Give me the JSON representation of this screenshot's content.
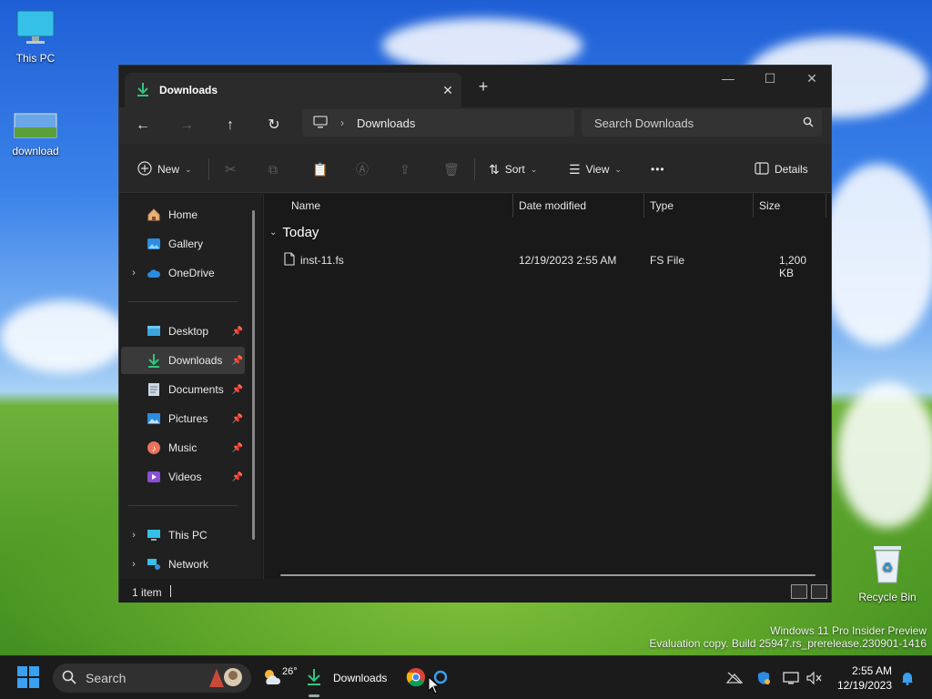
{
  "desktop": {
    "icons": [
      {
        "label": "This PC"
      },
      {
        "label": "download"
      },
      {
        "label": "Recycle Bin"
      }
    ],
    "watermark": {
      "line1": "Windows 11 Pro Insider Preview",
      "line2": "Evaluation copy. Build 25947.rs_prerelease.230901-1416"
    }
  },
  "window": {
    "tab": {
      "label": "Downloads",
      "close": "✕"
    },
    "new_tab": "+",
    "controls": {
      "minimize": "—",
      "maximize": "☐",
      "close": "✕"
    },
    "address": {
      "crumb": "Downloads"
    },
    "search": {
      "placeholder": "Search Downloads"
    },
    "commands": {
      "new": "New",
      "sort": "Sort",
      "view": "View",
      "more": "•••",
      "details": "Details"
    },
    "nav": {
      "home": "Home",
      "gallery": "Gallery",
      "onedrive": "OneDrive",
      "desktop": "Desktop",
      "downloads": "Downloads",
      "documents": "Documents",
      "pictures": "Pictures",
      "music": "Music",
      "videos": "Videos",
      "thispc": "This PC",
      "network": "Network"
    },
    "columns": {
      "name": "Name",
      "date": "Date modified",
      "type": "Type",
      "size": "Size"
    },
    "group": "Today",
    "files": [
      {
        "name": "inst-11.fs",
        "date": "12/19/2023 2:55 AM",
        "type": "FS File",
        "size": "1,200 KB"
      }
    ],
    "status": {
      "count": "1 item"
    }
  },
  "taskbar": {
    "search_placeholder": "Search",
    "weather_temp": "26°",
    "active_app": "Downloads",
    "clock": {
      "time": "2:55 AM",
      "date": "12/19/2023"
    }
  },
  "colors": {
    "accent_download": "#33c481",
    "onedrive": "#2b8ce0",
    "window_bg": "#1c1c1c"
  }
}
